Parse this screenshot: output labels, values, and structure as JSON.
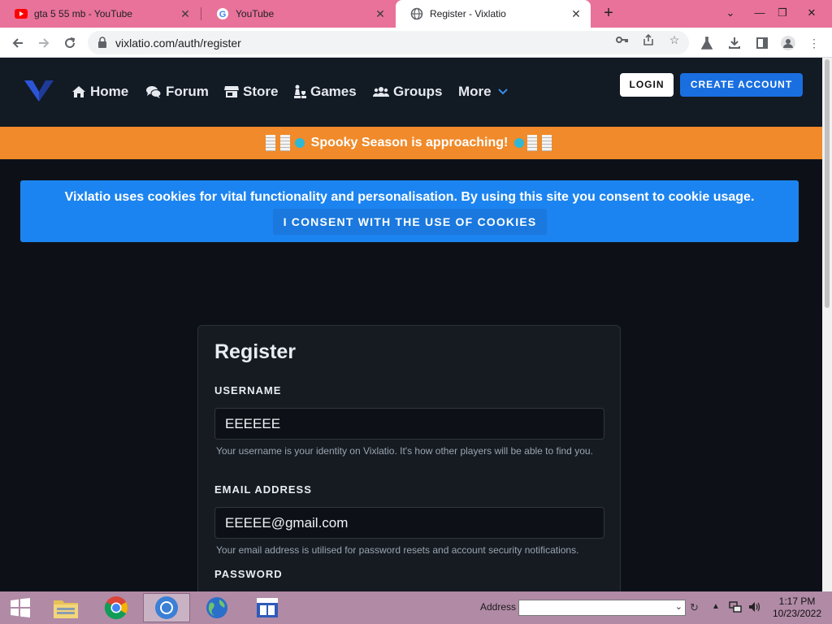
{
  "browser": {
    "tabs": [
      {
        "title": "gta 5 55 mb - YouTube",
        "icon": "youtube-icon",
        "active": false
      },
      {
        "title": "YouTube",
        "icon": "google-icon",
        "active": false
      },
      {
        "title": "Register - Vixlatio",
        "icon": "globe-icon",
        "active": true
      }
    ],
    "url": "vixlatio.com/auth/register"
  },
  "site": {
    "nav": {
      "items": [
        "Home",
        "Forum",
        "Store",
        "Games",
        "Groups",
        "More"
      ],
      "login": "LOGIN",
      "create_account": "CREATE ACCOUNT"
    },
    "promo": "Spooky Season is approaching!",
    "cookie": {
      "message": "Vixlatio uses cookies for vital functionality and personalisation. By using this site you consent to cookie usage.",
      "button": "I CONSENT WITH THE USE OF COOKIES"
    },
    "form": {
      "title": "Register",
      "username_label": "USERNAME",
      "username_value": "EEEEEE",
      "username_help": "Your username is your identity on Vixlatio. It's how other players will be able to find you.",
      "email_label": "EMAIL ADDRESS",
      "email_value": "EEEEE@gmail.com",
      "email_help": "Your email address is utilised for password resets and account security notifications.",
      "password_label": "PASSWORD"
    }
  },
  "taskbar": {
    "address_label": "Address",
    "time": "1:17 PM",
    "date": "10/23/2022"
  },
  "colors": {
    "tabstrip": "#e8729a",
    "site_bg": "#0d1117",
    "promo": "#f08a2a",
    "cookie": "#1c84f0",
    "create_account": "#1a6fe0",
    "taskbar": "#b18aa6"
  }
}
